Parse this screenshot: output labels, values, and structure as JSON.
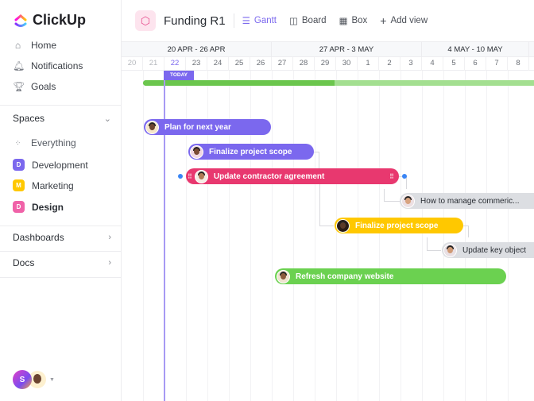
{
  "brand": {
    "name": "ClickUp"
  },
  "sidebar": {
    "nav": [
      {
        "label": "Home",
        "icon": "home-icon"
      },
      {
        "label": "Notifications",
        "icon": "bell-icon"
      },
      {
        "label": "Goals",
        "icon": "trophy-icon"
      }
    ],
    "spaces_label": "Spaces",
    "everything_label": "Everything",
    "spaces": [
      {
        "letter": "D",
        "label": "Development",
        "color": "#7b68ee"
      },
      {
        "letter": "M",
        "label": "Marketing",
        "color": "#ffc800"
      },
      {
        "letter": "D",
        "label": "Design",
        "color": "#f062a8"
      }
    ],
    "dashboards_label": "Dashboards",
    "docs_label": "Docs",
    "user_initial": "S"
  },
  "header": {
    "title": "Funding R1",
    "views": [
      {
        "label": "Gantt"
      },
      {
        "label": "Board"
      },
      {
        "label": "Box"
      }
    ],
    "add_view": "Add view"
  },
  "timeline": {
    "weeks": [
      "20 APR - 26 APR",
      "27 APR - 3 MAY",
      "4 MAY - 10 MAY"
    ],
    "days": [
      "20",
      "21",
      "22",
      "23",
      "24",
      "25",
      "26",
      "27",
      "28",
      "29",
      "30",
      "1",
      "2",
      "3",
      "4",
      "5",
      "6",
      "7",
      "8"
    ],
    "today_label": "TODAY",
    "progress_percent": 49
  },
  "tasks": [
    {
      "label": "Plan for next year",
      "color": "#7b68ee"
    },
    {
      "label": "Finalize project scope",
      "color": "#7b68ee"
    },
    {
      "label": "Update contractor agreement",
      "color": "#e8386f"
    },
    {
      "label": "How to manage commeric...",
      "color": "#dcdee2"
    },
    {
      "label": "Finalize project scope",
      "color": "#ffc800"
    },
    {
      "label": "Update key object",
      "color": "#dcdee2"
    },
    {
      "label": "Refresh company website",
      "color": "#6bd150"
    }
  ]
}
